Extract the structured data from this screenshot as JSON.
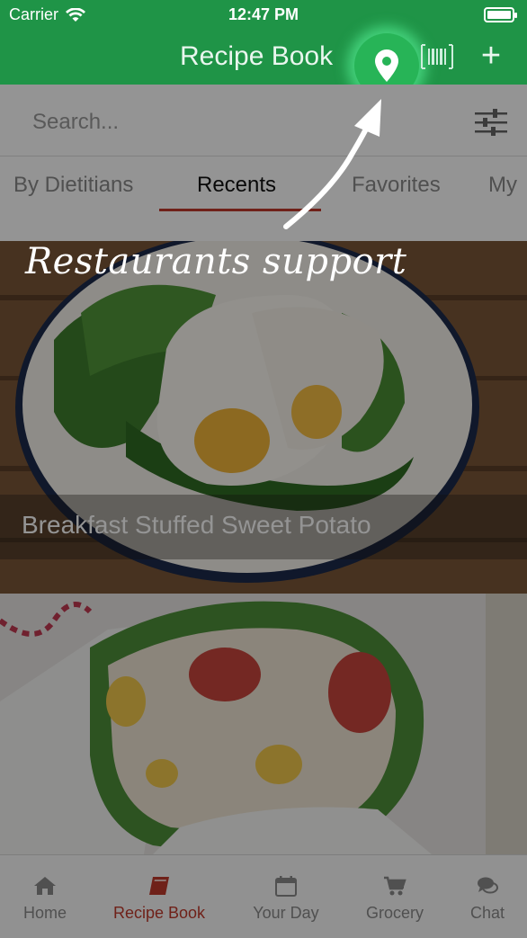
{
  "status_bar": {
    "carrier": "Carrier",
    "time": "12:47 PM"
  },
  "nav": {
    "title": "Recipe Book",
    "plus": "+"
  },
  "search": {
    "placeholder": "Search..."
  },
  "tabs": [
    {
      "label": "By Dietitians"
    },
    {
      "label": "Recents"
    },
    {
      "label": "Favorites"
    },
    {
      "label": "My"
    }
  ],
  "cards": [
    {
      "title": "Breakfast Stuffed Sweet Potato"
    },
    {
      "title": ""
    }
  ],
  "tabbar": [
    {
      "label": "Home",
      "icon": "home-icon"
    },
    {
      "label": "Recipe Book",
      "icon": "book-icon"
    },
    {
      "label": "Your Day",
      "icon": "calendar-icon"
    },
    {
      "label": "Grocery",
      "icon": "cart-icon"
    },
    {
      "label": "Chat",
      "icon": "chat-icon"
    }
  ],
  "annotation": {
    "text": "Restaurants support"
  },
  "colors": {
    "brand_green": "#1f9447",
    "accent_red": "#c0392b",
    "highlight_green": "#27b457"
  }
}
